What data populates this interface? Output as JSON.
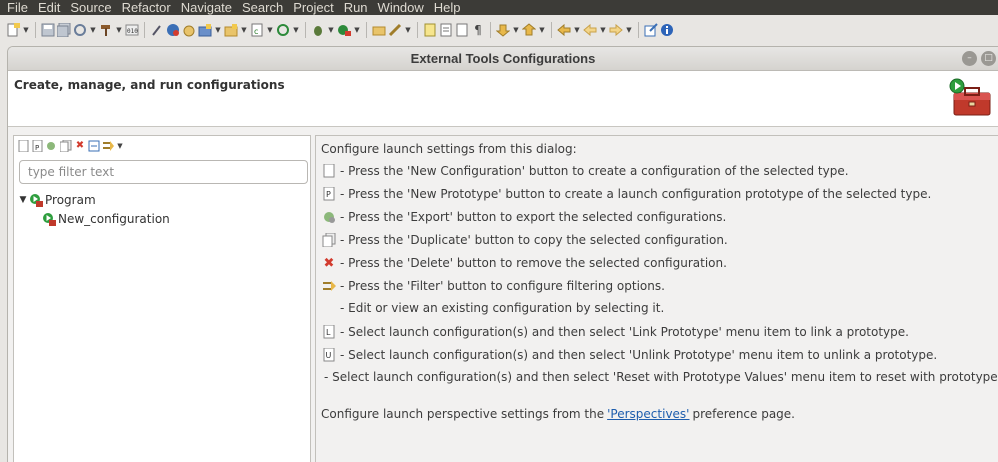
{
  "menubar": {
    "items": [
      "File",
      "Edit",
      "Source",
      "Refactor",
      "Navigate",
      "Search",
      "Project",
      "Run",
      "Window",
      "Help"
    ]
  },
  "dialog": {
    "title": "External Tools Configurations",
    "header_text": "Create, manage, and run configurations",
    "filter_placeholder": "type filter text",
    "tree": {
      "parent_label": "Program",
      "child_label": "New_configuration"
    },
    "help": {
      "intro": "Configure launch settings from this dialog:",
      "lines": [
        "- Press the 'New Configuration' button to create a configuration of the selected type.",
        "- Press the 'New Prototype' button to create a launch configuration prototype of the selected type.",
        "- Press the 'Export' button to export the selected configurations.",
        "- Press the 'Duplicate' button to copy the selected configuration.",
        "- Press the 'Delete' button to remove the selected configuration.",
        "- Press the 'Filter' button to configure filtering options.",
        "- Edit or view an existing configuration by selecting it.",
        "- Select launch configuration(s) and then select 'Link Prototype' menu item to link a prototype.",
        "- Select launch configuration(s) and then select 'Unlink Prototype' menu item to unlink a prototype.",
        "- Select launch configuration(s) and then select 'Reset with Prototype Values' menu item to reset with prototype values."
      ],
      "perspective_prefix": "Configure launch perspective settings from the",
      "perspective_link": "'Perspectives'",
      "perspective_suffix": "preference page."
    }
  },
  "icons": {
    "line_icons": [
      "new-config-icon",
      "new-prototype-icon",
      "export-icon",
      "duplicate-icon",
      "delete-icon",
      "filter-icon",
      "",
      "link-prototype-icon",
      "unlink-prototype-icon",
      ""
    ]
  },
  "colors": {
    "menubar_bg": "#3c3b37",
    "link": "#1d5dad",
    "delete_red": "#d23b2e"
  }
}
